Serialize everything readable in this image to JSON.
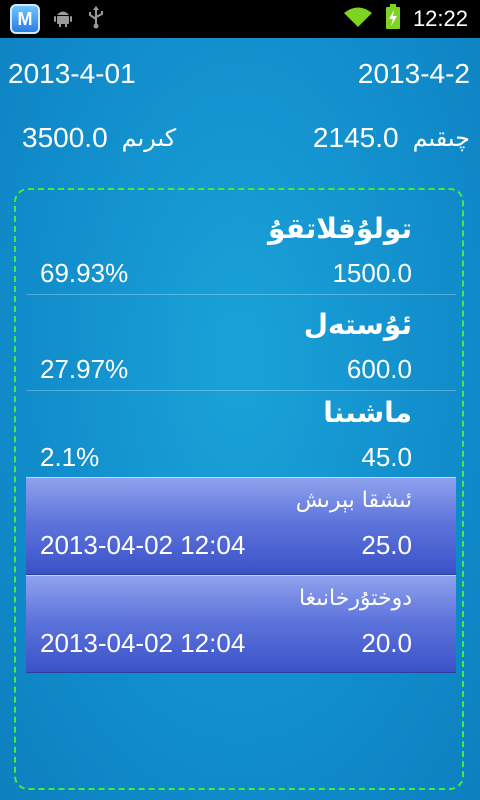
{
  "status_bar": {
    "time": "12:22",
    "app_badge_letter": "M"
  },
  "header": {
    "start_date": "2013-4-01",
    "end_date": "2013-4-2"
  },
  "summary": {
    "income_value": "3500.0",
    "income_label": "كىرىم",
    "expense_value": "2145.0",
    "expense_label": "چىقىم"
  },
  "categories": [
    {
      "label": "تولۇقلاتقۇ",
      "percent": "69.93%",
      "amount": "1500.0"
    },
    {
      "label": "ئۇستەل",
      "percent": "27.97%",
      "amount": "600.0"
    },
    {
      "label": "ماشىنا",
      "percent": "2.1%",
      "amount": "45.0"
    }
  ],
  "transactions": [
    {
      "label": "ئىشقا بېرىش",
      "datetime": "2013-04-02 12:04",
      "amount": "25.0"
    },
    {
      "label": "دوختۇرخانىغا",
      "datetime": "2013-04-02 12:04",
      "amount": "20.0"
    }
  ],
  "colors": {
    "background": "#128fcd",
    "panel_border": "#3ef03e",
    "transaction_fill": "#5f75dc"
  }
}
